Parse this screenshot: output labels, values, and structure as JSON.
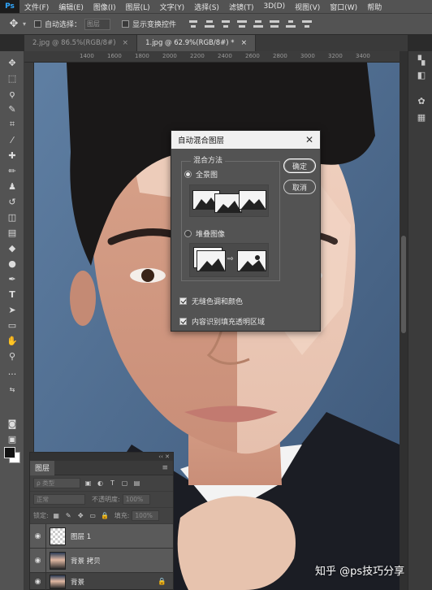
{
  "menu": {
    "items": [
      "文件(F)",
      "编辑(E)",
      "图像(I)",
      "图层(L)",
      "文字(Y)",
      "选择(S)",
      "滤镜(T)",
      "3D(D)",
      "视图(V)",
      "窗口(W)",
      "帮助"
    ]
  },
  "options_bar": {
    "auto_select_label": "自动选择：",
    "auto_select_value": "图层",
    "show_transform_label": "显示变换控件"
  },
  "tabs": [
    {
      "label": "2.jpg @ 86.5%(RGB/8#)",
      "close": "×"
    },
    {
      "label": "1.jpg @ 62.9%(RGB/8#) *",
      "close": "×"
    }
  ],
  "ruler": {
    "marks": [
      "1400",
      "1600",
      "1800",
      "2000",
      "2200",
      "2400",
      "2600",
      "2800",
      "3000",
      "3200",
      "3400"
    ]
  },
  "dialog": {
    "title": "自动混合图层",
    "close": "✕",
    "group_label": "混合方法",
    "option_panorama": "全景图",
    "option_stack": "堆叠图像",
    "ok": "确定",
    "cancel": "取消",
    "check_seamless": "无缝色调和颜色",
    "check_content_aware": "内容识别填充透明区域"
  },
  "layers_panel": {
    "tab": "图层",
    "menu": "≡",
    "collapse": "‹‹ ✕",
    "filter_label": "ρ 类型",
    "blend_mode": "正常",
    "opacity_label": "不透明度:",
    "opacity_value": "100%",
    "lock_label": "锁定:",
    "fill_label": "填充:",
    "fill_value": "100%",
    "layers": [
      {
        "name": "图层 1"
      },
      {
        "name": "背景 拷贝"
      },
      {
        "name": "背景"
      }
    ]
  },
  "watermark": "知乎 @ps技巧分享",
  "colors": {
    "ui_dark": "#535353",
    "dialog_title_bg": "#f0f0f0",
    "photo_bg": "#4b6686",
    "ps_accent": "#31a8ff"
  }
}
